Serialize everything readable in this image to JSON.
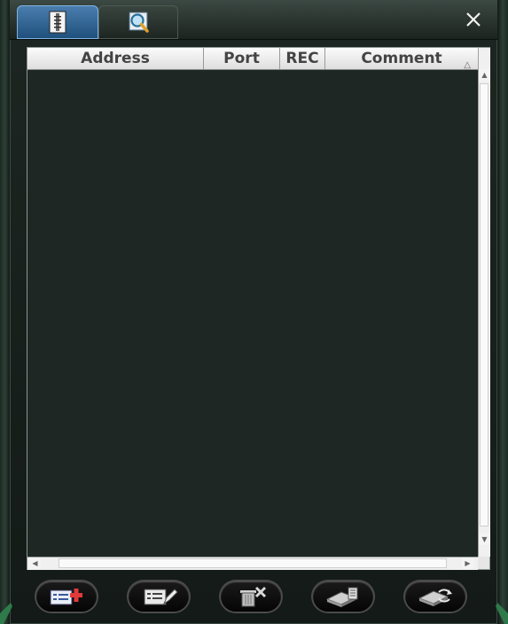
{
  "window": {
    "tabs": [
      {
        "icon": "address-book-icon",
        "active": true
      },
      {
        "icon": "magnifier-icon",
        "active": false
      }
    ],
    "close_icon": "close-icon"
  },
  "table": {
    "columns": [
      {
        "label": "Address"
      },
      {
        "label": "Port"
      },
      {
        "label": "REC"
      },
      {
        "label": "Comment",
        "sort": "ascending"
      }
    ],
    "rows": []
  },
  "toolbar": {
    "buttons": [
      {
        "icon": "add-entry-icon"
      },
      {
        "icon": "edit-entry-icon"
      },
      {
        "icon": "delete-entry-icon"
      },
      {
        "icon": "import-icon"
      },
      {
        "icon": "export-icon"
      }
    ]
  },
  "colors": {
    "accent_tab": "#2c6aa5",
    "list_background": "#1e2724",
    "frame": "#1d2622",
    "add_cross": "#e23a3a"
  }
}
